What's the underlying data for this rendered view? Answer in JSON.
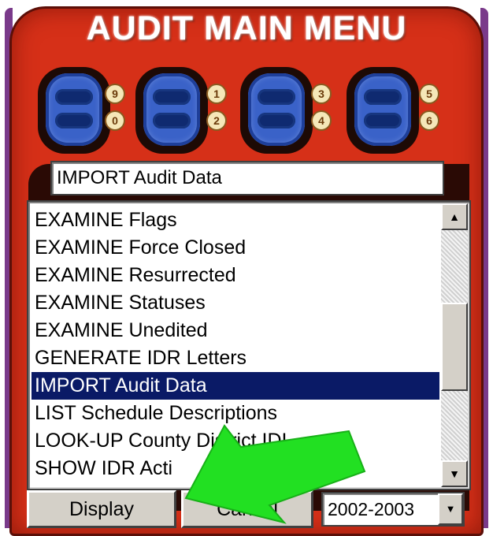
{
  "window": {
    "title": "AUDIT MAIN MENU"
  },
  "selector_buttons": [
    {
      "top_label": "9",
      "bottom_label": "0"
    },
    {
      "top_label": "1",
      "bottom_label": "2"
    },
    {
      "top_label": "3",
      "bottom_label": "4"
    },
    {
      "top_label": "5",
      "bottom_label": "6"
    }
  ],
  "display_field": {
    "value": "IMPORT Audit Data"
  },
  "menu_list": {
    "items": [
      "EXAMINE Flags",
      "EXAMINE Force Closed",
      "EXAMINE Resurrected",
      "EXAMINE Statuses",
      "EXAMINE Unedited",
      "GENERATE IDR Letters",
      "IMPORT Audit Data",
      "LIST Schedule Descriptions",
      "LOOK-UP County District IDI",
      "SHOW IDR Acti"
    ],
    "selected_index": 6
  },
  "buttons": {
    "display_label": "Display",
    "cancel_label": "Cancel"
  },
  "year_select": {
    "value": "2002-2003"
  },
  "icons": {
    "scroll_up": "▲",
    "scroll_down": "▼",
    "dropdown": "▼"
  },
  "colors": {
    "device": "#d63018",
    "selection": "#0a1a66",
    "annotation_arrow": "#22e022"
  }
}
